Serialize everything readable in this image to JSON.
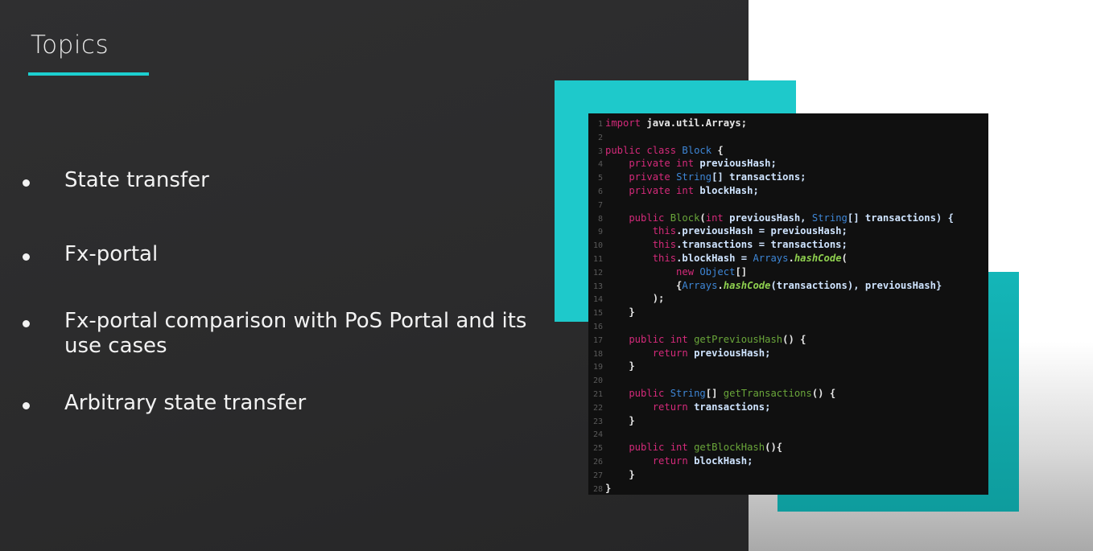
{
  "slide": {
    "title": "Topics",
    "bullets": [
      "State transfer",
      "Fx-portal",
      "Fx-portal comparison with PoS Portal and its use cases",
      "Arbitrary state transfer"
    ]
  },
  "colors": {
    "accent": "#1ec9cb",
    "slide_bg": "#2b2b2c",
    "code_bg": "#101010"
  },
  "code": {
    "lines": [
      [
        {
          "t": "import ",
          "c": "kw"
        },
        {
          "t": "java.util.Arrays;",
          "c": "pl"
        }
      ],
      [],
      [
        {
          "t": "public class ",
          "c": "kw"
        },
        {
          "t": "Block",
          "c": "ty"
        },
        {
          "t": " {",
          "c": "pl"
        }
      ],
      [
        {
          "t": "    private int ",
          "c": "kw"
        },
        {
          "t": "previousHash;",
          "c": "id"
        }
      ],
      [
        {
          "t": "    private ",
          "c": "kw"
        },
        {
          "t": "String",
          "c": "ty"
        },
        {
          "t": "[] transactions;",
          "c": "id"
        }
      ],
      [
        {
          "t": "    private int ",
          "c": "kw"
        },
        {
          "t": "blockHash;",
          "c": "id"
        }
      ],
      [],
      [
        {
          "t": "    public ",
          "c": "kw"
        },
        {
          "t": "Block",
          "c": "fn"
        },
        {
          "t": "(",
          "c": "pl"
        },
        {
          "t": "int ",
          "c": "kw"
        },
        {
          "t": "previousHash, ",
          "c": "id"
        },
        {
          "t": "String",
          "c": "ty"
        },
        {
          "t": "[] transactions) {",
          "c": "id"
        }
      ],
      [
        {
          "t": "        this",
          "c": "this"
        },
        {
          "t": ".previousHash = previousHash;",
          "c": "id"
        }
      ],
      [
        {
          "t": "        this",
          "c": "this"
        },
        {
          "t": ".transactions = transactions;",
          "c": "id"
        }
      ],
      [
        {
          "t": "        this",
          "c": "this"
        },
        {
          "t": ".blockHash = ",
          "c": "id"
        },
        {
          "t": "Arrays",
          "c": "ty"
        },
        {
          "t": ".",
          "c": "pl"
        },
        {
          "t": "hashCode",
          "c": "mt"
        },
        {
          "t": "(",
          "c": "pl"
        }
      ],
      [
        {
          "t": "            new ",
          "c": "kw"
        },
        {
          "t": "Object",
          "c": "ty"
        },
        {
          "t": "[]",
          "c": "pl"
        }
      ],
      [
        {
          "t": "            {",
          "c": "pl"
        },
        {
          "t": "Arrays",
          "c": "ty"
        },
        {
          "t": ".",
          "c": "pl"
        },
        {
          "t": "hashCode",
          "c": "mt"
        },
        {
          "t": "(transactions), previousHash}",
          "c": "id"
        }
      ],
      [
        {
          "t": "        );",
          "c": "pl"
        }
      ],
      [
        {
          "t": "    }",
          "c": "pl"
        }
      ],
      [],
      [
        {
          "t": "    public int ",
          "c": "kw"
        },
        {
          "t": "getPreviousHash",
          "c": "fn"
        },
        {
          "t": "() {",
          "c": "pl"
        }
      ],
      [
        {
          "t": "        return ",
          "c": "kw"
        },
        {
          "t": "previousHash;",
          "c": "id"
        }
      ],
      [
        {
          "t": "    }",
          "c": "pl"
        }
      ],
      [],
      [
        {
          "t": "    public ",
          "c": "kw"
        },
        {
          "t": "String",
          "c": "ty"
        },
        {
          "t": "[] ",
          "c": "pl"
        },
        {
          "t": "getTransactions",
          "c": "fn"
        },
        {
          "t": "() {",
          "c": "pl"
        }
      ],
      [
        {
          "t": "        return ",
          "c": "kw"
        },
        {
          "t": "transactions;",
          "c": "id"
        }
      ],
      [
        {
          "t": "    }",
          "c": "pl"
        }
      ],
      [],
      [
        {
          "t": "    public int ",
          "c": "kw"
        },
        {
          "t": "getBlockHash",
          "c": "fn"
        },
        {
          "t": "(){",
          "c": "pl"
        }
      ],
      [
        {
          "t": "        return ",
          "c": "kw"
        },
        {
          "t": "blockHash;",
          "c": "id"
        }
      ],
      [
        {
          "t": "    }",
          "c": "pl"
        }
      ],
      [
        {
          "t": "}",
          "c": "pl"
        }
      ]
    ]
  }
}
